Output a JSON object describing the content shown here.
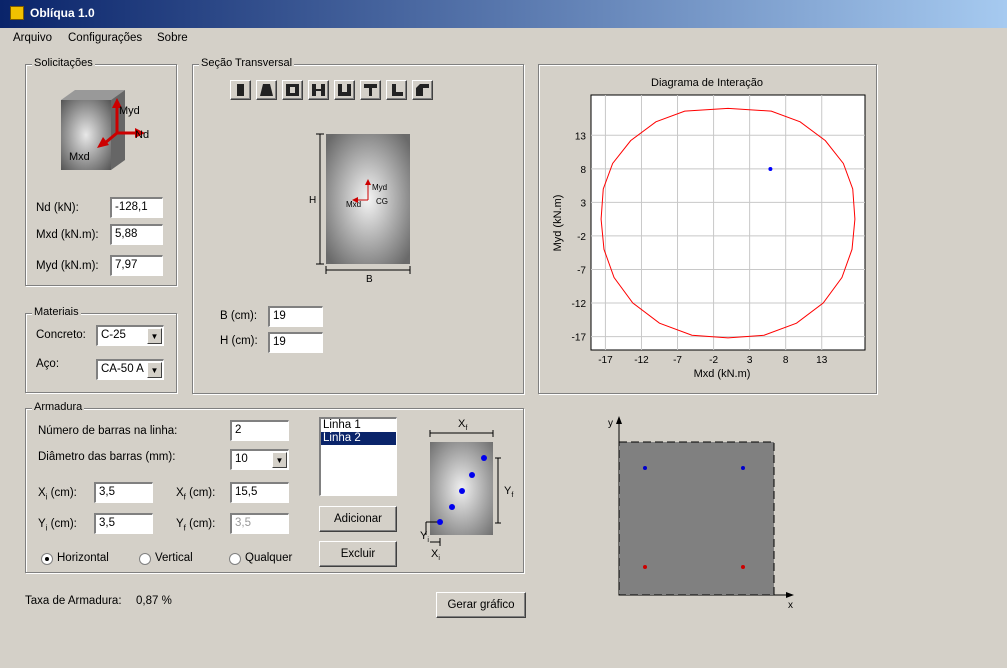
{
  "window": {
    "title": "Oblíqua 1.0"
  },
  "menu": [
    "Arquivo",
    "Configurações",
    "Sobre"
  ],
  "solicitacoes": {
    "title": "Solicitações",
    "icon_labels": {
      "myd": "Myd",
      "nd": "Nd",
      "mxd": "Mxd"
    },
    "nd_label": "Nd (kN):",
    "nd_value": "-128,1",
    "mxd_label": "Mxd (kN.m):",
    "mxd_value": "5,88",
    "myd_label": "Myd (kN.m):",
    "myd_value": "7,97"
  },
  "secao": {
    "title": "Seção Transversal",
    "h_label": "H",
    "b_label": "B",
    "myd": "Myd",
    "mxd": "Mxd",
    "cg": "CG",
    "b_field_label": "B (cm):",
    "b_value": "19",
    "h_field_label": "H (cm):",
    "h_value": "19"
  },
  "materiais": {
    "title": "Materiais",
    "concreto_label": "Concreto:",
    "concreto_value": "C-25",
    "aco_label": "Aço:",
    "aco_value": "CA-50 A"
  },
  "armadura": {
    "title": "Armadura",
    "nbarras_label": "Número de barras na linha:",
    "nbarras_value": "2",
    "diametro_label": "Diâmetro das barras (mm):",
    "diametro_value": "10",
    "xi_label": "X",
    "xi_sub": "i",
    "xi_unit": "(cm):",
    "xi_value": "3,5",
    "xf_label": "X",
    "xf_sub": "f",
    "xf_unit": "(cm):",
    "xf_value": "15,5",
    "yi_label": "Y",
    "yi_sub": "i",
    "yi_unit": "(cm):",
    "yi_value": "3,5",
    "yf_label": "Y",
    "yf_sub": "f",
    "yf_unit": "(cm):",
    "yf_value": "3,5",
    "lines": [
      "Linha 1",
      "Linha 2"
    ],
    "selected_line": "Linha 2",
    "adicionar": "Adicionar",
    "excluir": "Excluir",
    "orientation": {
      "horizontal": "Horizontal",
      "vertical": "Vertical",
      "qualquer": "Qualquer",
      "selected": "horizontal"
    },
    "diagram": {
      "xf": "X",
      "xf_sub": "f",
      "yf": "Y",
      "yf_sub": "f",
      "yi": "Y",
      "yi_sub": "i",
      "xi": "X",
      "xi_sub": "i"
    }
  },
  "taxa": {
    "label": "Taxa de Armadura:",
    "value": "0,87 %"
  },
  "gerar": "Gerar gráfico",
  "section_plot": {
    "y_label": "y",
    "x_label": "x"
  },
  "chart_data": {
    "type": "scatter",
    "title": "Diagrama de Interação",
    "xlabel": "Mxd (kN.m)",
    "ylabel": "Myd (kN.m)",
    "xlim": [
      -19,
      19
    ],
    "ylim": [
      -19,
      19
    ],
    "xticks": [
      -17,
      -12,
      -7,
      -2,
      3,
      8,
      13
    ],
    "yticks": [
      13,
      8,
      3,
      -2,
      -7,
      -12,
      -17
    ],
    "grid": true,
    "colors": {
      "envelope": "#ff0000",
      "point": "#0000ff"
    },
    "series": [
      {
        "type": "line",
        "x": [
          0,
          6,
          10,
          13.5,
          16,
          17.3,
          17.6,
          17.2,
          15.8,
          13.2,
          9.5,
          5,
          0,
          -5,
          -9.5,
          -13.2,
          -15.8,
          -17.2,
          -17.6,
          -17.3,
          -16,
          -13.5,
          -10,
          -6,
          0
        ],
        "y": [
          17,
          16.6,
          15,
          12.2,
          8.8,
          5,
          0.5,
          -4,
          -8.2,
          -12,
          -15,
          -16.8,
          -17.2,
          -16.8,
          -15,
          -12,
          -8.2,
          -4,
          0.5,
          5,
          8.8,
          12.2,
          15,
          16.6,
          17
        ]
      },
      {
        "type": "scatter",
        "x": [
          5.88
        ],
        "y": [
          7.97
        ]
      }
    ]
  }
}
